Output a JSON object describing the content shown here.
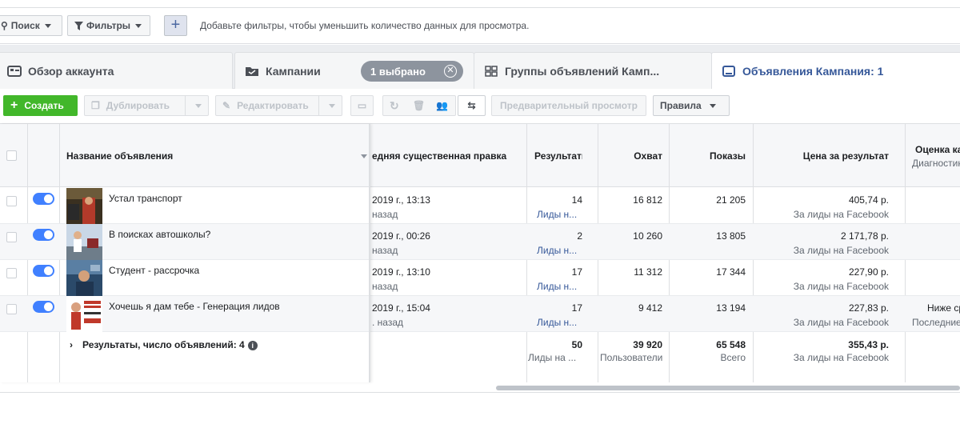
{
  "filterbar": {
    "search_label": "Поиск",
    "filters_label": "Фильтры",
    "add_label": "+",
    "hint": "Добавьте фильтры, чтобы уменьшить количество данных для просмотра."
  },
  "tabs": {
    "account": "Обзор аккаунта",
    "campaigns": "Кампании",
    "selected": "1 выбрано",
    "adsets": "Группы объявлений Камп...",
    "ads": "Объявления Кампания: 1"
  },
  "toolbar": {
    "create": "Создать",
    "duplicate": "Дублировать",
    "edit": "Редактировать",
    "preview": "Предварительный просмотр",
    "rules": "Правила"
  },
  "columns": {
    "name": "Название объявления",
    "last_edit": "едняя существенная правка",
    "results": "Результаты",
    "reach": "Охват",
    "impressions": "Показы",
    "cost": "Цена за результат",
    "quality": "Оценка ка",
    "quality_sub": "Диагностик"
  },
  "rows": [
    {
      "name": "Устал транспорт",
      "date": "2019 г., 13:13",
      "ago": "назад",
      "results": "14",
      "results_sub": "Лиды н...",
      "reach": "16 812",
      "impressions": "21 205",
      "cost": "405,74 р.",
      "cost_sub": "За лиды на Facebook",
      "quality": "",
      "quality_sub": ""
    },
    {
      "name": "В поисках автошколы?",
      "date": "2019 г., 00:26",
      "ago": "назад",
      "results": "2",
      "results_sub": "Лиды н...",
      "reach": "10 260",
      "impressions": "13 805",
      "cost": "2 171,78 р.",
      "cost_sub": "За лиды на Facebook",
      "quality": "",
      "quality_sub": ""
    },
    {
      "name": "Студент - рассрочка",
      "date": "2019 г., 13:10",
      "ago": "назад",
      "results": "17",
      "results_sub": "Лиды н...",
      "reach": "11 312",
      "impressions": "17 344",
      "cost": "227,90 р.",
      "cost_sub": "За лиды на Facebook",
      "quality": "",
      "quality_sub": ""
    },
    {
      "name": "Хочешь я дам тебе - Генерация лидов",
      "date": "2019 г., 15:04",
      "ago": ". назад",
      "results": "17",
      "results_sub": "Лиды н...",
      "reach": "9 412",
      "impressions": "13 194",
      "cost": "227,83 р.",
      "cost_sub": "За лиды на Facebook",
      "quality": "Ниже ср",
      "quality_sub": "Последние"
    }
  ],
  "totals": {
    "label": "Результаты, число объявлений: 4",
    "results": "50",
    "results_sub": "Лиды на ...",
    "reach": "39 920",
    "reach_sub": "Пользователи",
    "impressions": "65 548",
    "impressions_sub": "Всего",
    "cost": "355,43 р.",
    "cost_sub": "За лиды на Facebook"
  },
  "colors": {
    "accent": "#365899",
    "create": "#42b72a",
    "toggle": "#4080ff"
  }
}
